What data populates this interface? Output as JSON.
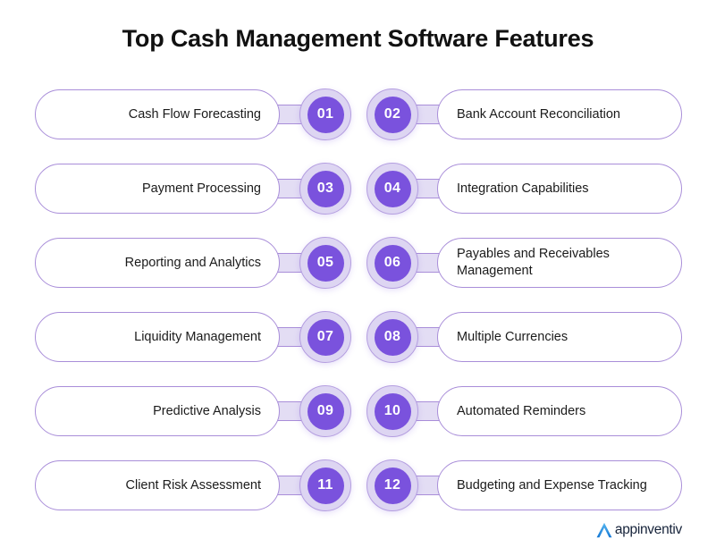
{
  "header": {
    "title": "Top Cash Management Software Features"
  },
  "colors": {
    "accent_purple": "#7a52dd",
    "badge_ring": "#ddd5f2",
    "border_purple": "#a98ed9",
    "connector_fill": "#e3ddf4",
    "title_text": "#111111",
    "label_text": "#1b1b1b",
    "logo_blue": "#1e8ce0",
    "logo_text": "#16233a",
    "background": "#ffffff"
  },
  "features": [
    {
      "number": "01",
      "label": "Cash Flow Forecasting",
      "side": "left"
    },
    {
      "number": "02",
      "label": "Bank Account Reconciliation",
      "side": "right"
    },
    {
      "number": "03",
      "label": "Payment Processing",
      "side": "left"
    },
    {
      "number": "04",
      "label": "Integration Capabilities",
      "side": "right"
    },
    {
      "number": "05",
      "label": "Reporting and Analytics",
      "side": "left"
    },
    {
      "number": "06",
      "label": "Payables and Receivables Management",
      "side": "right"
    },
    {
      "number": "07",
      "label": "Liquidity Management",
      "side": "left"
    },
    {
      "number": "08",
      "label": "Multiple Currencies",
      "side": "right"
    },
    {
      "number": "09",
      "label": "Predictive Analysis",
      "side": "left"
    },
    {
      "number": "10",
      "label": "Automated Reminders",
      "side": "right"
    },
    {
      "number": "11",
      "label": "Client Risk Assessment",
      "side": "left"
    },
    {
      "number": "12",
      "label": "Budgeting and Expense Tracking",
      "side": "right"
    }
  ],
  "rows": [
    {
      "left_index": 0,
      "right_index": 1
    },
    {
      "left_index": 2,
      "right_index": 3
    },
    {
      "left_index": 4,
      "right_index": 5
    },
    {
      "left_index": 6,
      "right_index": 7
    },
    {
      "left_index": 8,
      "right_index": 9
    },
    {
      "left_index": 10,
      "right_index": 11
    }
  ],
  "branding": {
    "logo_text": "appinventiv",
    "logo_icon": "appinventiv-a-chevron-icon"
  }
}
